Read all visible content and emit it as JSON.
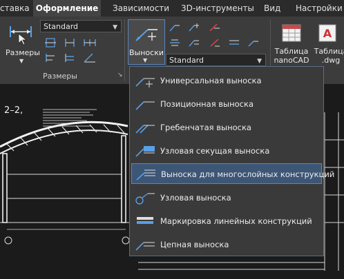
{
  "tabs": [
    {
      "label": "ставка"
    },
    {
      "label": "Оформление"
    },
    {
      "label": "Зависимости"
    },
    {
      "label": "3D-инструменты"
    },
    {
      "label": "Вид"
    },
    {
      "label": "Настройки"
    }
  ],
  "ribbon": {
    "dims_combo": "Standard",
    "dims_button": "Размеры",
    "dims_panel_label": "Размеры",
    "leaders_button": "Выноски",
    "leaders_combo": "Standard",
    "table_nanocad": "Таблица nanoCAD",
    "table_dwg": "Таблица .dwg"
  },
  "drawing": {
    "heading": "2–2,"
  },
  "menu": {
    "items": [
      {
        "label": "Универсальная выноска"
      },
      {
        "label": "Позиционная выноска"
      },
      {
        "label": "Гребенчатая выноска"
      },
      {
        "label": "Узловая секущая выноска"
      },
      {
        "label": "Выноска для многослойных конструкций"
      },
      {
        "label": "Узловая выноска"
      },
      {
        "label": "Маркировка линейных конструкций"
      },
      {
        "label": "Цепная выноска"
      }
    ],
    "highlighted_index": 4
  },
  "colors": {
    "ribbon": "#3c3c3c",
    "menu_highlight": "#3d5676",
    "icon_blue": "#5aa0e6",
    "icon_red": "#e04848"
  }
}
